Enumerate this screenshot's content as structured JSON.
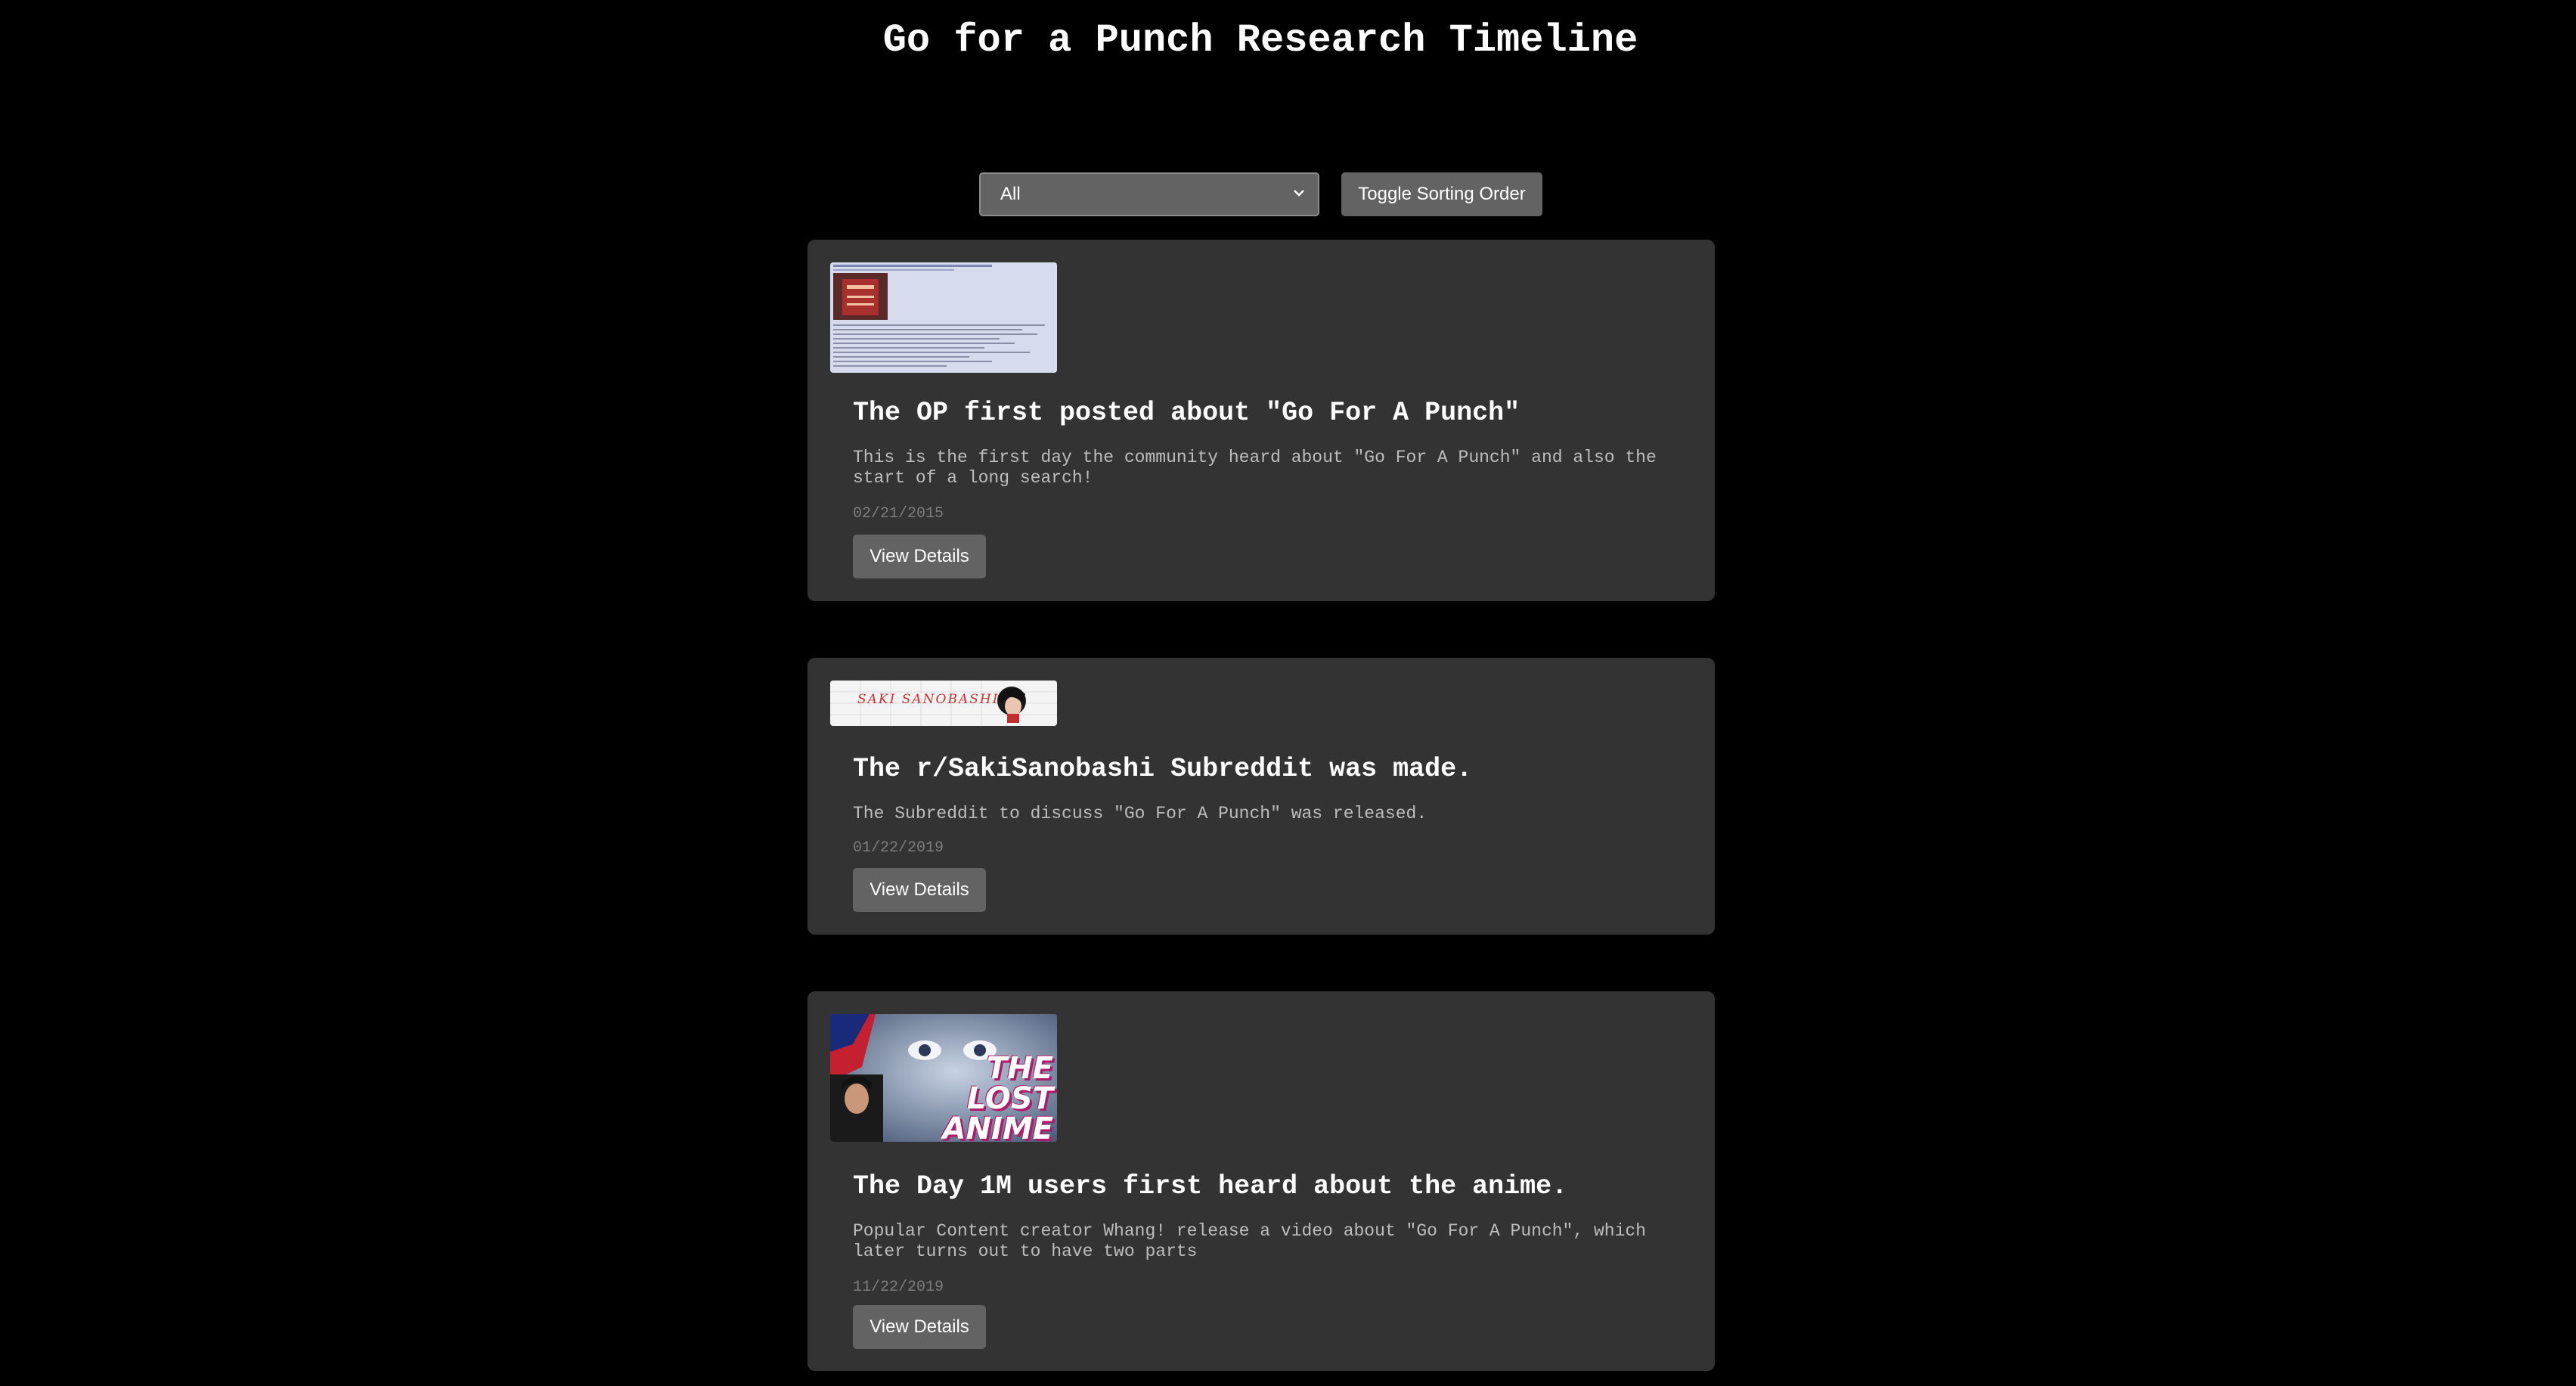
{
  "header": {
    "title": "Go for a Punch Research Timeline"
  },
  "controls": {
    "filter_value": "All",
    "toggle_label": "Toggle Sorting Order"
  },
  "events": [
    {
      "title": "The OP first posted about \"Go For A Punch\"",
      "description": "This is the first day the community heard about \"Go For A Punch\" and also the start of a long search!",
      "date": "02/21/2015",
      "button_label": "View Details",
      "thumbnail": "forum-post-screenshot"
    },
    {
      "title": "The r/SakiSanobashi Subreddit was made.",
      "description": "The Subreddit to discuss \"Go For A Punch\" was released.",
      "date": "01/22/2019",
      "button_label": "View Details",
      "thumbnail": "subreddit-banner",
      "thumbnail_text": "SAKI SANOBASHI"
    },
    {
      "title": "The Day 1M users first heard about the anime.",
      "description": "Popular Content creator Whang! release a video about \"Go For A Punch\", which later turns out to have two parts",
      "date": "11/22/2019",
      "button_label": "View Details",
      "thumbnail": "video-thumbnail",
      "thumbnail_text": "THE LOST ANIME"
    }
  ]
}
